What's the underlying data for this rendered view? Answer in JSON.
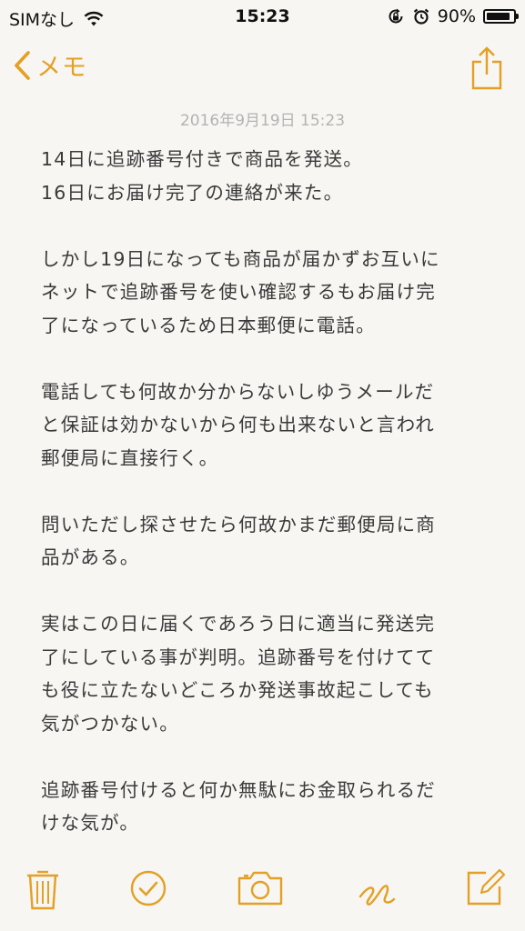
{
  "status_bar": {
    "carrier": "SIMなし",
    "time": "15:23",
    "battery_percent": "90%",
    "battery_level": 0.9,
    "icons": [
      "wifi-icon",
      "orientation-lock-icon",
      "alarm-icon",
      "battery-icon"
    ]
  },
  "nav": {
    "back_label": "メモ",
    "back_icon": "chevron-left-icon",
    "share_icon": "share-icon"
  },
  "note": {
    "date": "2016年9月19日 15:23",
    "paragraphs": [
      [
        "14日に追跡番号付きで商品を発送。",
        "16日にお届け完了の連絡が来た。"
      ],
      [
        "しかし19日になっても商品が届かずお互いに",
        "ネットで追跡番号を使い確認するもお届け完",
        "了になっているため日本郵便に電話。"
      ],
      [
        "電話しても何故か分からないしゆうメールだ",
        "と保証は効かないから何も出来ないと言われ",
        "郵便局に直接行く。"
      ],
      [
        "問いただし探させたら何故かまだ郵便局に商",
        "品がある。"
      ],
      [
        "実はこの日に届くであろう日に適当に発送完",
        "了にしている事が判明。追跡番号を付けてて",
        "も役に立たないどころか発送事故起こしても",
        "気がつかない。"
      ],
      [
        "追跡番号付けると何か無駄にお金取られるだ",
        "けな気が。"
      ]
    ]
  },
  "toolbar": {
    "icons": [
      "trash-icon",
      "checklist-icon",
      "camera-icon",
      "sketch-icon",
      "compose-icon"
    ]
  },
  "colors": {
    "accent": "#e3a024",
    "background": "#f7f6f3",
    "text": "#3a3a3a",
    "date": "#b3b3b3"
  }
}
